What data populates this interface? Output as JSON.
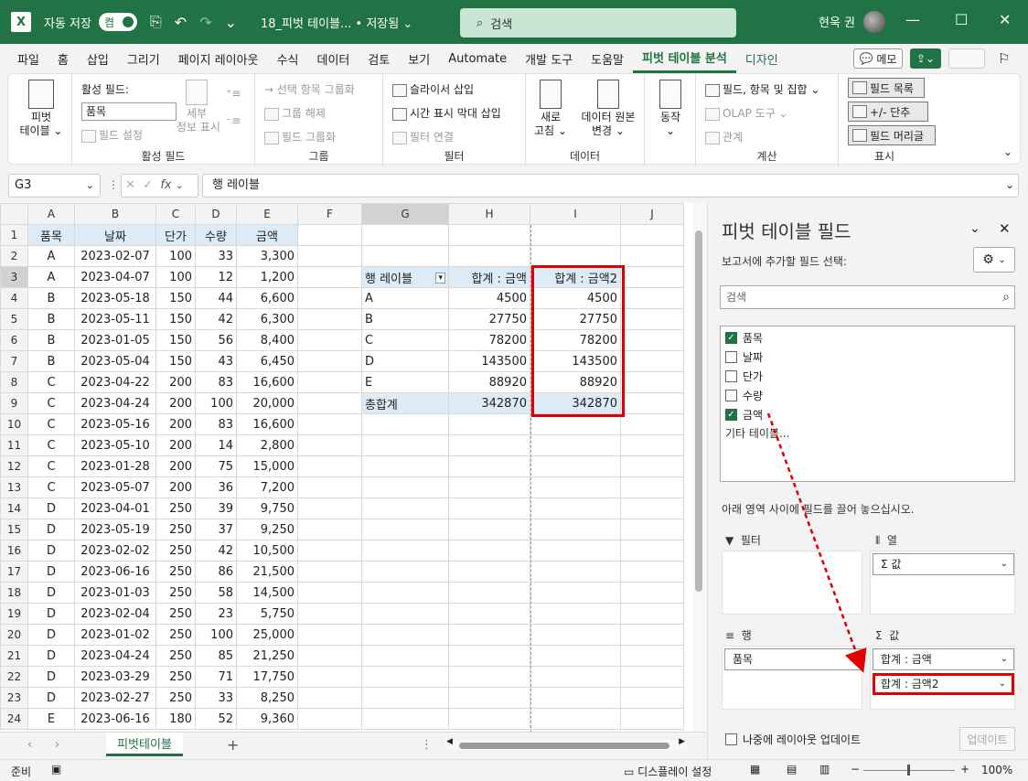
{
  "titlebar": {
    "autosave": "자동 저장",
    "toggle": "켬",
    "filename": "18_피벗 테이블... • 저장됨 ⌄",
    "search": "검색",
    "user": "현욱 권"
  },
  "tabs": [
    "파일",
    "홈",
    "삽입",
    "그리기",
    "페이지 레이아웃",
    "수식",
    "데이터",
    "검토",
    "보기",
    "Automate",
    "개발 도구",
    "도움말",
    "피벗 테이블 분석",
    "디자인"
  ],
  "active_tab": "피벗 테이블 분석",
  "memo": "메모",
  "ribbon": {
    "pivot": "피벗\n테이블 ⌄",
    "active_field_label": "활성 필드:",
    "active_field_value": "품목",
    "field_settings": "필드 설정",
    "drill": "세부\n정보 표시",
    "g_active": "활성 필드",
    "sel_group": "→ 선택 항목 그룹화",
    "ungroup": "그룹 해제",
    "group_field": "필드 그룹화",
    "g_group": "그룹",
    "slicer": "슬라이서 삽입",
    "timeline": "시간 표시 막대 삽입",
    "filter_conn": "필터 연결",
    "g_filter": "필터",
    "refresh": "새로\n고침 ⌄",
    "change_src": "데이터 원본\n변경 ⌄",
    "g_data": "데이터",
    "action": "동작\n⌄",
    "calc_field": "필드, 항목 및 집합 ⌄",
    "olap": "OLAP 도구 ⌄",
    "relations": "관계",
    "g_calc": "계산",
    "field_list": "필드 목록",
    "plusminus": "+/- 단추",
    "field_headers": "필드 머리글",
    "g_show": "표시"
  },
  "namebox": "G3",
  "formula": "행 레이블",
  "columns": [
    "A",
    "B",
    "C",
    "D",
    "E",
    "F",
    "G",
    "H",
    "I",
    "J"
  ],
  "headers": [
    "품목",
    "날짜",
    "단가",
    "수량",
    "금액"
  ],
  "rows": [
    [
      "A",
      "2023-02-07",
      "100",
      "33",
      "3,300"
    ],
    [
      "A",
      "2023-04-07",
      "100",
      "12",
      "1,200"
    ],
    [
      "B",
      "2023-05-18",
      "150",
      "44",
      "6,600"
    ],
    [
      "B",
      "2023-05-11",
      "150",
      "42",
      "6,300"
    ],
    [
      "B",
      "2023-01-05",
      "150",
      "56",
      "8,400"
    ],
    [
      "B",
      "2023-05-04",
      "150",
      "43",
      "6,450"
    ],
    [
      "C",
      "2023-04-22",
      "200",
      "83",
      "16,600"
    ],
    [
      "C",
      "2023-04-24",
      "200",
      "100",
      "20,000"
    ],
    [
      "C",
      "2023-05-16",
      "200",
      "83",
      "16,600"
    ],
    [
      "C",
      "2023-05-10",
      "200",
      "14",
      "2,800"
    ],
    [
      "C",
      "2023-01-28",
      "200",
      "75",
      "15,000"
    ],
    [
      "C",
      "2023-05-07",
      "200",
      "36",
      "7,200"
    ],
    [
      "D",
      "2023-04-01",
      "250",
      "39",
      "9,750"
    ],
    [
      "D",
      "2023-05-19",
      "250",
      "37",
      "9,250"
    ],
    [
      "D",
      "2023-02-02",
      "250",
      "42",
      "10,500"
    ],
    [
      "D",
      "2023-06-16",
      "250",
      "86",
      "21,500"
    ],
    [
      "D",
      "2023-01-03",
      "250",
      "58",
      "14,500"
    ],
    [
      "D",
      "2023-02-04",
      "250",
      "23",
      "5,750"
    ],
    [
      "D",
      "2023-01-02",
      "250",
      "100",
      "25,000"
    ],
    [
      "D",
      "2023-04-24",
      "250",
      "85",
      "21,250"
    ],
    [
      "D",
      "2023-03-29",
      "250",
      "71",
      "17,750"
    ],
    [
      "D",
      "2023-02-27",
      "250",
      "33",
      "8,250"
    ],
    [
      "E",
      "2023-06-16",
      "180",
      "52",
      "9,360"
    ]
  ],
  "pivot": {
    "headers": [
      "행 레이블",
      "합계 : 금액",
      "합계 : 금액2"
    ],
    "rows": [
      [
        "A",
        "4500",
        "4500"
      ],
      [
        "B",
        "27750",
        "27750"
      ],
      [
        "C",
        "78200",
        "78200"
      ],
      [
        "D",
        "143500",
        "143500"
      ],
      [
        "E",
        "88920",
        "88920"
      ]
    ],
    "total": [
      "총합계",
      "342870",
      "342870"
    ]
  },
  "sheet_tab": "피벗테이블",
  "status": {
    "ready": "준비",
    "display": "디스플레이 설정",
    "zoom": "100%"
  },
  "pane": {
    "title": "피벗 테이블 필드",
    "subtitle": "보고서에 추가할 필드 선택:",
    "search": "검색",
    "fields": [
      {
        "name": "품목",
        "checked": true
      },
      {
        "name": "날짜",
        "checked": false
      },
      {
        "name": "단가",
        "checked": false
      },
      {
        "name": "수량",
        "checked": false
      },
      {
        "name": "금액",
        "checked": true
      }
    ],
    "more": "기타 테이블...",
    "drag_note": "아래 영역 사이에 필드를 끌어 놓으십시오.",
    "filter_label": "필터",
    "columns_label": "열",
    "rows_label": "행",
    "values_label": "값",
    "columns_item": "Σ 값",
    "rows_item": "품목",
    "values_items": [
      "합계 : 금액",
      "합계 : 금액2"
    ],
    "lazy": "나중에 레이아웃 업데이트",
    "update": "업데이트"
  },
  "colors": {
    "accent": "#217346",
    "highlight": "#e00000",
    "header_fill": "#ddebf7"
  }
}
